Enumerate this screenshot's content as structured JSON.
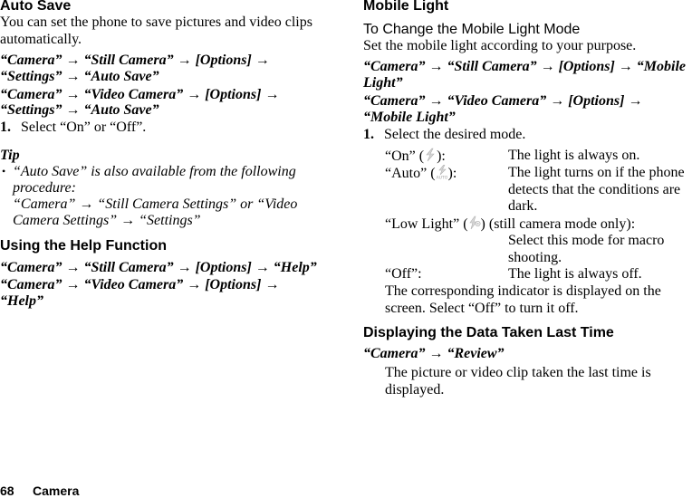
{
  "left": {
    "auto_save": {
      "title": "Auto Save",
      "desc_line1": "You can set the phone to save pictures and video clips",
      "desc_line2": "automatically.",
      "path1_line1": "“Camera” → “Still Camera” → [Options] →",
      "path1_line2": "“Settings” → “Auto Save”",
      "path2_line1": "“Camera” → “Video Camera” → [Options] →",
      "path2_line2": "“Settings” → “Auto Save”",
      "step_num": "1.",
      "step_text": "Select “On” or “Off”."
    },
    "tip": {
      "title": "Tip",
      "bullet": "•",
      "line1": "“Auto Save” is also available from the following",
      "line2": "procedure:",
      "line3": "“Camera” → “Still Camera Settings” or “Video",
      "line4": "Camera Settings” → “Settings”"
    },
    "help": {
      "title": "Using the Help Function",
      "path1": "“Camera” → “Still Camera” → [Options] → “Help”",
      "path2_line1": "“Camera” → “Video Camera” → [Options] →",
      "path2_line2": "“Help”"
    }
  },
  "right": {
    "mobile_light": {
      "title": "Mobile Light",
      "subtitle": "To Change the Mobile Light Mode",
      "desc": "Set the mobile light according to your purpose.",
      "path1_line1": "“Camera” → “Still Camera” → [Options] → “Mobile",
      "path1_line2": "Light”",
      "path2_line1": "“Camera” → “Video Camera” → [Options] →",
      "path2_line2": "“Mobile Light”",
      "step_num": "1.",
      "step_text": "Select the desired mode.",
      "modes": [
        {
          "label_pre": "“On” (",
          "label_post": "):",
          "icon": "flash-on-icon",
          "desc": [
            "The light is always on."
          ]
        },
        {
          "label_pre": "“Auto” (",
          "label_post": "):",
          "icon": "flash-auto-icon",
          "desc": [
            "The light turns on if the phone",
            "detects that the conditions are",
            "dark."
          ]
        },
        {
          "label_pre": "“Low Light” (",
          "label_post": ") (still camera mode only):",
          "icon": "low-light-icon",
          "desc": [
            "Select this mode for macro",
            "shooting."
          ]
        },
        {
          "label_pre": "“Off”:",
          "label_post": "",
          "icon": "",
          "desc": [
            "The light is always off."
          ]
        }
      ],
      "note_line1": "The corresponding indicator is displayed on the",
      "note_line2": "screen. Select “Off” to turn it off."
    },
    "review": {
      "title": "Displaying the Data Taken Last Time",
      "path": "“Camera” → “Review”",
      "desc_line1": "The picture or video clip taken the last time is",
      "desc_line2": "displayed."
    }
  },
  "footer": {
    "page_number": "68",
    "section": "Camera"
  }
}
